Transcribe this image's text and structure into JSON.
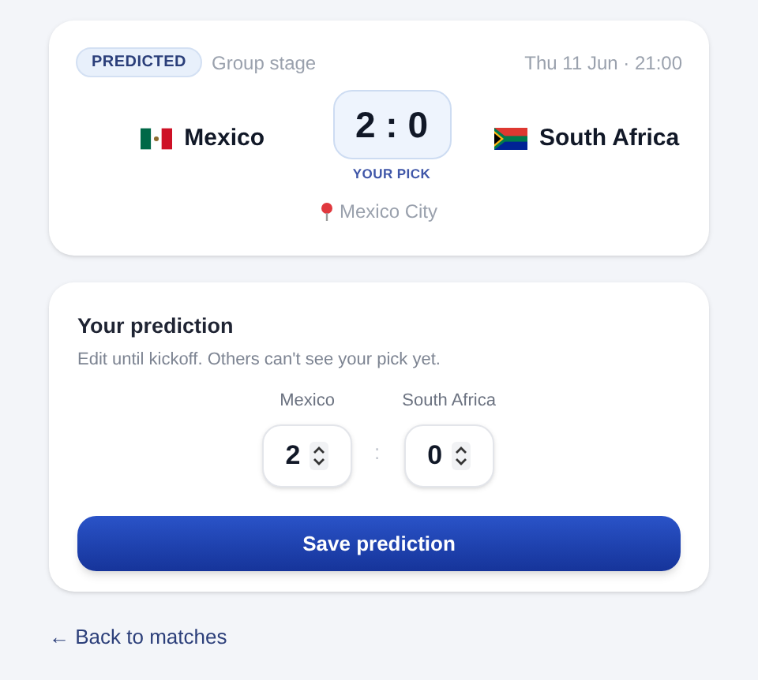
{
  "match": {
    "status": "PREDICTED",
    "stage": "Group stage",
    "datetime": "Thu 11 Jun · 21:00",
    "home": {
      "name": "Mexico"
    },
    "away": {
      "name": "South Africa"
    },
    "score": "2 : 0",
    "score_caption": "YOUR PICK",
    "venue": "Mexico City"
  },
  "prediction": {
    "title": "Your prediction",
    "subtitle": "Edit until kickoff. Others can't see your pick yet.",
    "inputs": [
      {
        "label": "Mexico",
        "value": "2"
      },
      {
        "label": "South Africa",
        "value": "0"
      }
    ],
    "separator": ":",
    "save_button": "Save prediction"
  },
  "back_link": "← Back to matches"
}
